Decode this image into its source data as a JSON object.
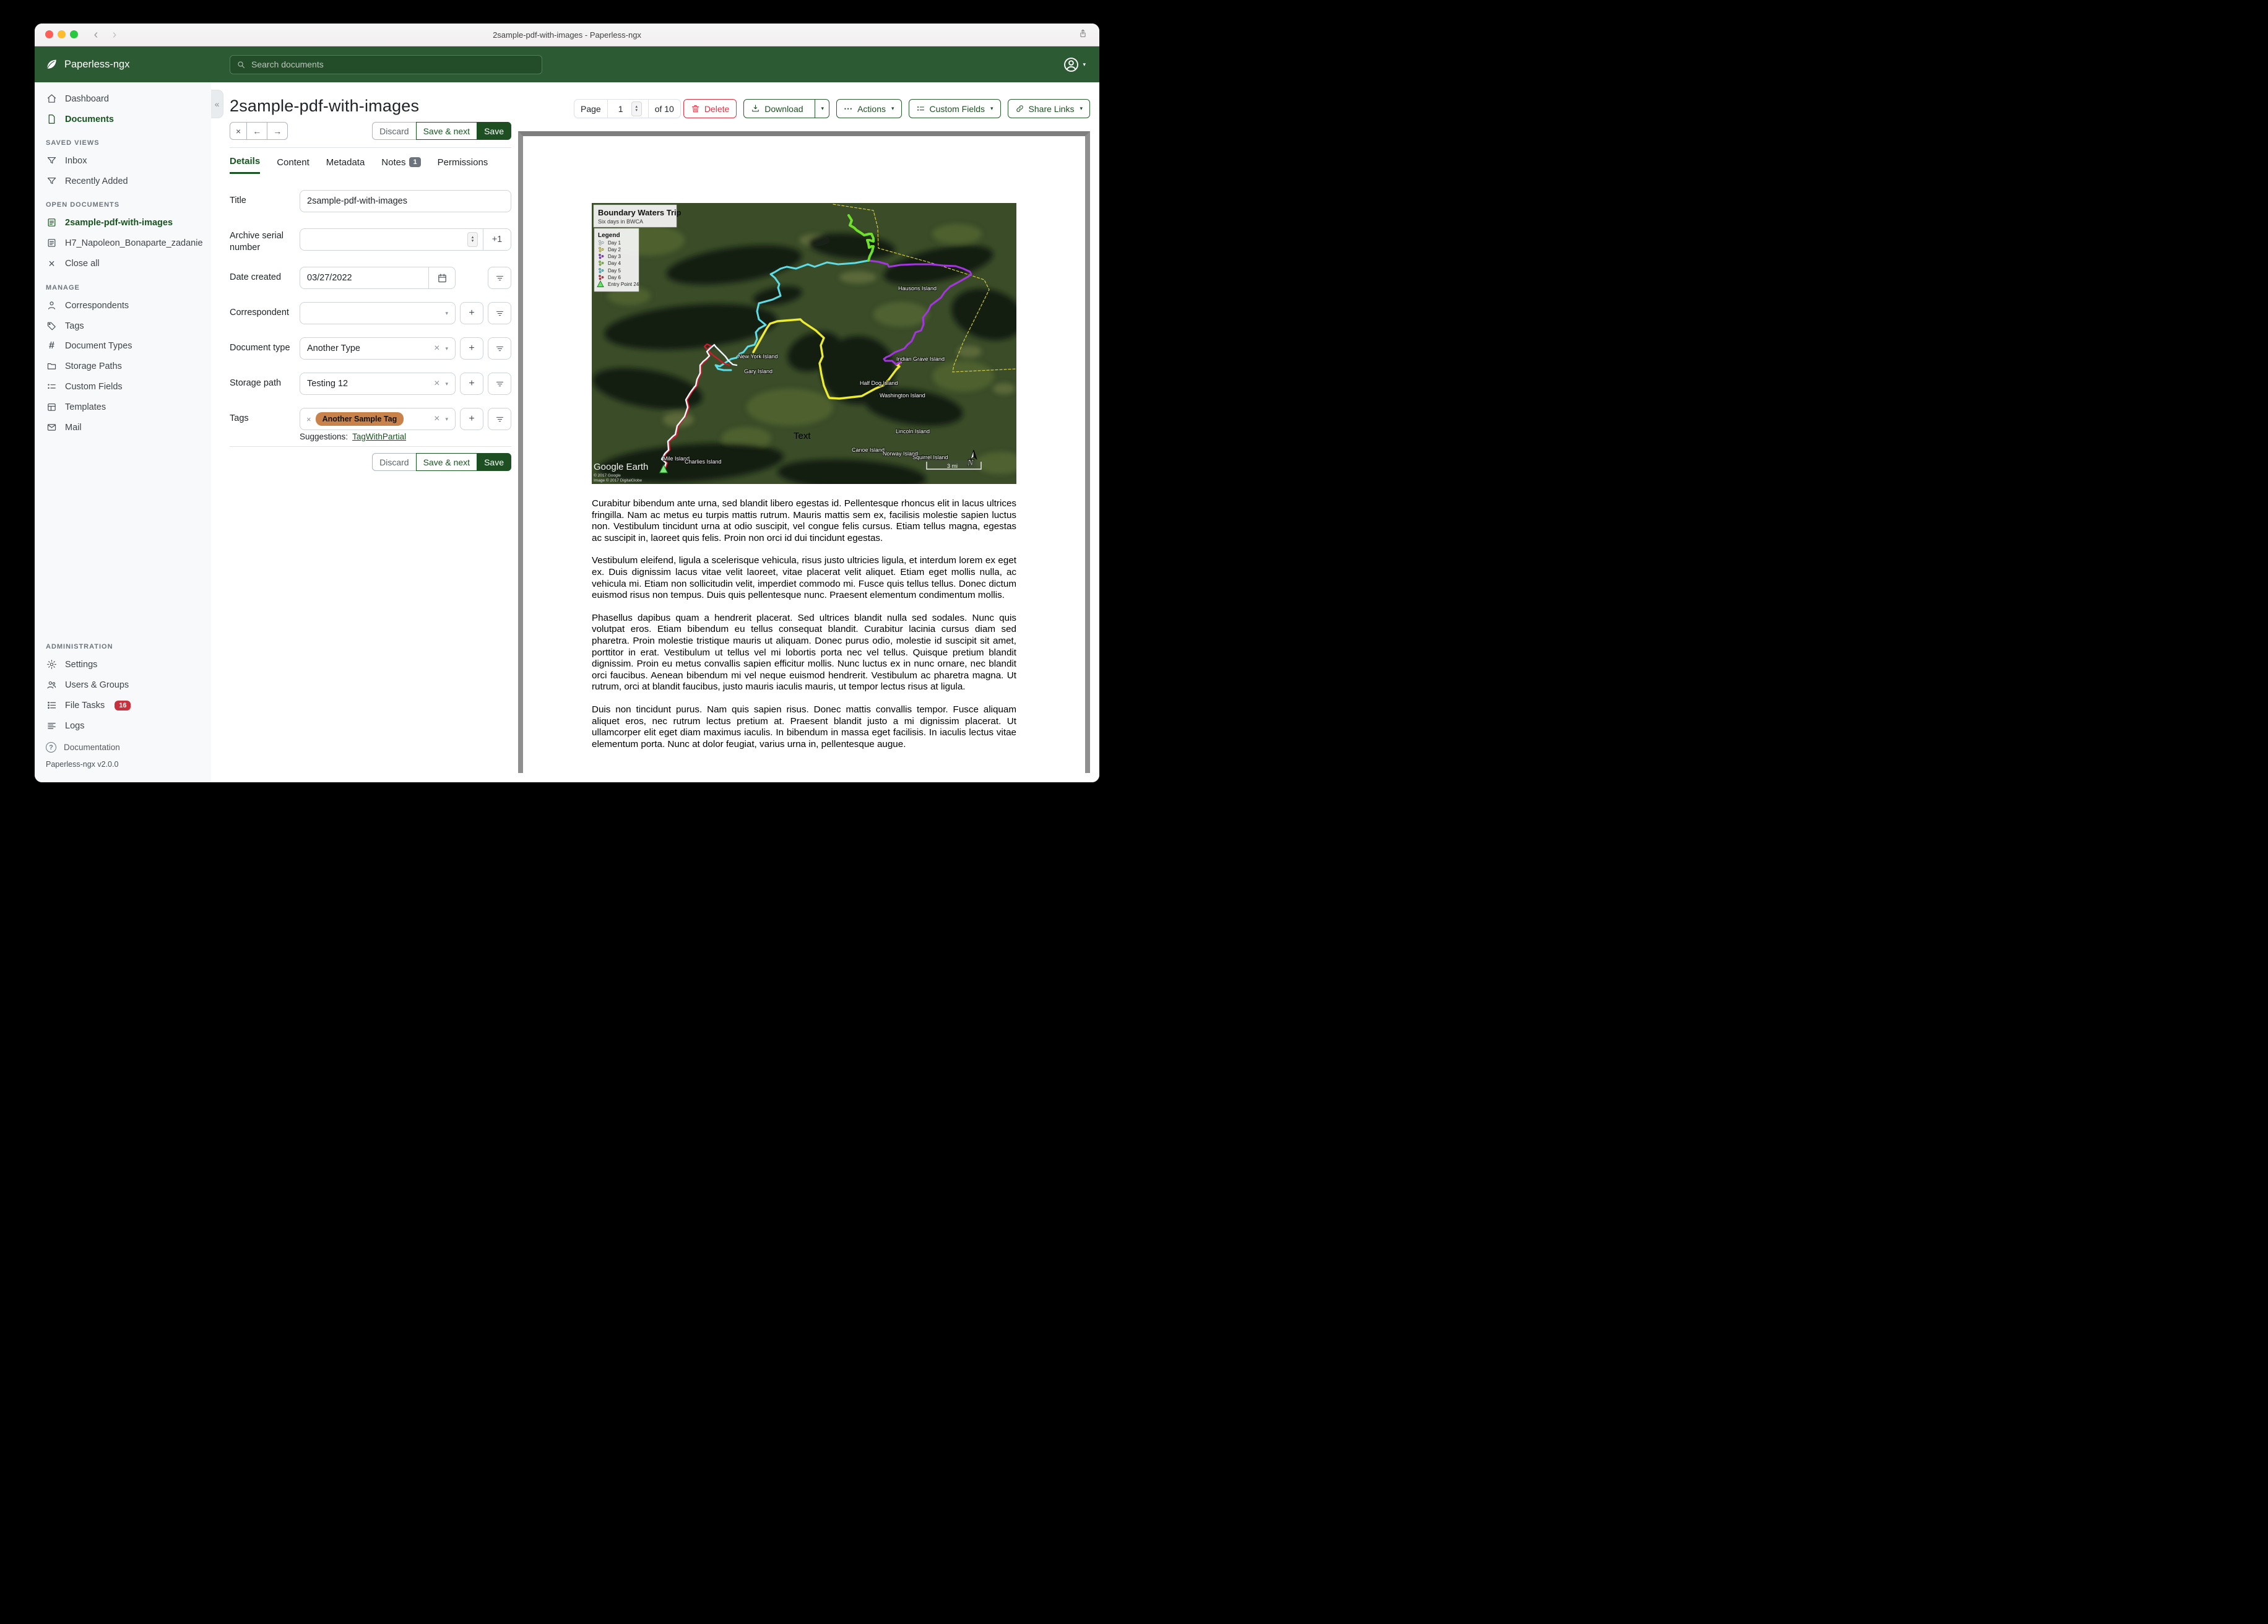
{
  "chrome": {
    "title": "2sample-pdf-with-images - Paperless-ngx"
  },
  "icons": {
    "close": "×",
    "back": "←",
    "forward": "→",
    "caret": "▾",
    "plus": "+",
    "collapse": "«",
    "chev_left": "‹",
    "chev_right": "›",
    "dots": "⋯",
    "help": "?",
    "spin_up": "▴",
    "spin_down": "▾"
  },
  "navbar": {
    "brand": "Paperless-ngx",
    "search_placeholder": "Search documents"
  },
  "sidebar": {
    "dashboard": "Dashboard",
    "documents": "Documents",
    "saved_views_heading": "SAVED VIEWS",
    "inbox": "Inbox",
    "recently_added": "Recently Added",
    "open_documents_heading": "OPEN DOCUMENTS",
    "open_doc_1": "2sample-pdf-with-images",
    "open_doc_2": "H7_Napoleon_Bonaparte_zadanie",
    "close_all": "Close all",
    "manage_heading": "MANAGE",
    "manage_items": [
      "Correspondents",
      "Tags",
      "Document Types",
      "Storage Paths",
      "Custom Fields",
      "Templates",
      "Mail"
    ],
    "admin_heading": "ADMINISTRATION",
    "settings": "Settings",
    "users_groups": "Users & Groups",
    "file_tasks": "File Tasks",
    "file_tasks_badge": "16",
    "logs": "Logs",
    "documentation": "Documentation",
    "version": "Paperless-ngx v2.0.0"
  },
  "editor": {
    "title": "2sample-pdf-with-images",
    "discard": "Discard",
    "save_next": "Save & next",
    "save": "Save",
    "tabs": {
      "details": "Details",
      "content": "Content",
      "metadata": "Metadata",
      "notes": "Notes",
      "notes_badge": "1",
      "permissions": "Permissions"
    },
    "fields": {
      "title_label": "Title",
      "title_value": "2sample-pdf-with-images",
      "asn_label": "Archive serial number",
      "asn_plus": "+1",
      "date_label": "Date created",
      "date_value": "03/27/2022",
      "correspondent_label": "Correspondent",
      "doc_type_label": "Document type",
      "doc_type_value": "Another Type",
      "storage_label": "Storage path",
      "storage_value": "Testing 12",
      "tags_label": "Tags",
      "tag_chip": "Another Sample Tag",
      "suggestions_label": "Suggestions:",
      "suggestion": "TagWithPartial"
    }
  },
  "preview": {
    "page_label": "Page",
    "page_value": "1",
    "page_total": "of 10",
    "delete": "Delete",
    "download": "Download",
    "actions": "Actions",
    "custom_fields": "Custom Fields",
    "share_links": "Share Links",
    "map": {
      "title": "Boundary Waters Trip",
      "subtitle": "Six days in BWCA",
      "legend_title": "Legend",
      "legend": [
        {
          "label": "Day 1",
          "color": "#dcecf2"
        },
        {
          "label": "Day 2",
          "color": "#d6d63c"
        },
        {
          "label": "Day 3",
          "color": "#8b2fc9"
        },
        {
          "label": "Day 4",
          "color": "#7cc832"
        },
        {
          "label": "Day 5",
          "color": "#43c8d2"
        },
        {
          "label": "Day 6",
          "color": "#c9293a"
        },
        {
          "label": "Entry Point 24",
          "color": "#6ade6a"
        }
      ],
      "labels": [
        "Hausons Island",
        "New York Island",
        "Gary Island",
        "Indian Grave Island",
        "Half Dog Island",
        "Washington Island",
        "Lincoln Island",
        "Canoe Island",
        "Norway Island",
        "Squirrel Island",
        "Mile Island",
        "Charlies Island",
        "Text"
      ],
      "watermark": "Google Earth",
      "copyright1": "© 2017 Google",
      "copyright2": "Image © 2017 DigitalGlobe",
      "scale": "3 mi",
      "north": "N",
      "route_colors": {
        "day1": "#eef6ff",
        "day2": "#efec2d",
        "day3": "#a435e0",
        "day4": "#6fe02a",
        "day5": "#5fdde6",
        "day6": "#d41a2a",
        "trail": "#d0ca45"
      }
    },
    "paragraphs": [
      "Curabitur bibendum ante urna, sed blandit libero egestas id. Pellentesque rhoncus elit in lacus ultrices fringilla. Nam ac metus eu turpis mattis rutrum. Mauris mattis sem ex, facilisis molestie sapien luctus non. Vestibulum tincidunt urna at odio suscipit, vel congue felis cursus. Etiam tellus magna, egestas ac suscipit in, laoreet quis felis. Proin non orci id dui tincidunt egestas.",
      "Vestibulum eleifend, ligula a scelerisque vehicula, risus justo ultricies ligula, et interdum lorem ex eget ex. Duis dignissim lacus vitae velit laoreet, vitae placerat velit aliquet. Etiam eget mollis nulla, ac vehicula mi. Etiam non sollicitudin velit, imperdiet commodo mi. Fusce quis tellus tellus. Donec dictum euismod risus non tempus. Duis quis pellentesque nunc. Praesent elementum condimentum mollis.",
      "Phasellus dapibus quam a hendrerit placerat. Sed ultrices blandit nulla sed sodales. Nunc quis volutpat eros. Etiam bibendum eu tellus consequat blandit. Curabitur lacinia cursus diam sed pharetra. Proin molestie tristique mauris ut aliquam. Donec purus odio, molestie id suscipit sit amet, porttitor in erat. Vestibulum ut tellus vel mi lobortis porta nec vel tellus. Quisque pretium blandit dignissim. Proin eu metus convallis sapien efficitur mollis. Nunc luctus ex in nunc ornare, nec blandit orci faucibus. Aenean bibendum mi vel neque euismod hendrerit. Vestibulum ac pharetra magna. Ut rutrum, orci at blandit faucibus, justo mauris iaculis mauris, ut tempor lectus risus at ligula.",
      "Duis non tincidunt purus. Nam quis sapien risus. Donec mattis convallis tempor. Fusce aliquam aliquet eros, nec rutrum lectus pretium at. Praesent blandit justo a mi dignissim placerat. Ut ullamcorper elit eget diam maximus iaculis. In bibendum in massa eget facilisis. In iaculis lectus vitae elementum porta. Nunc at dolor feugiat, varius urna in, pellentesque augue."
    ]
  }
}
